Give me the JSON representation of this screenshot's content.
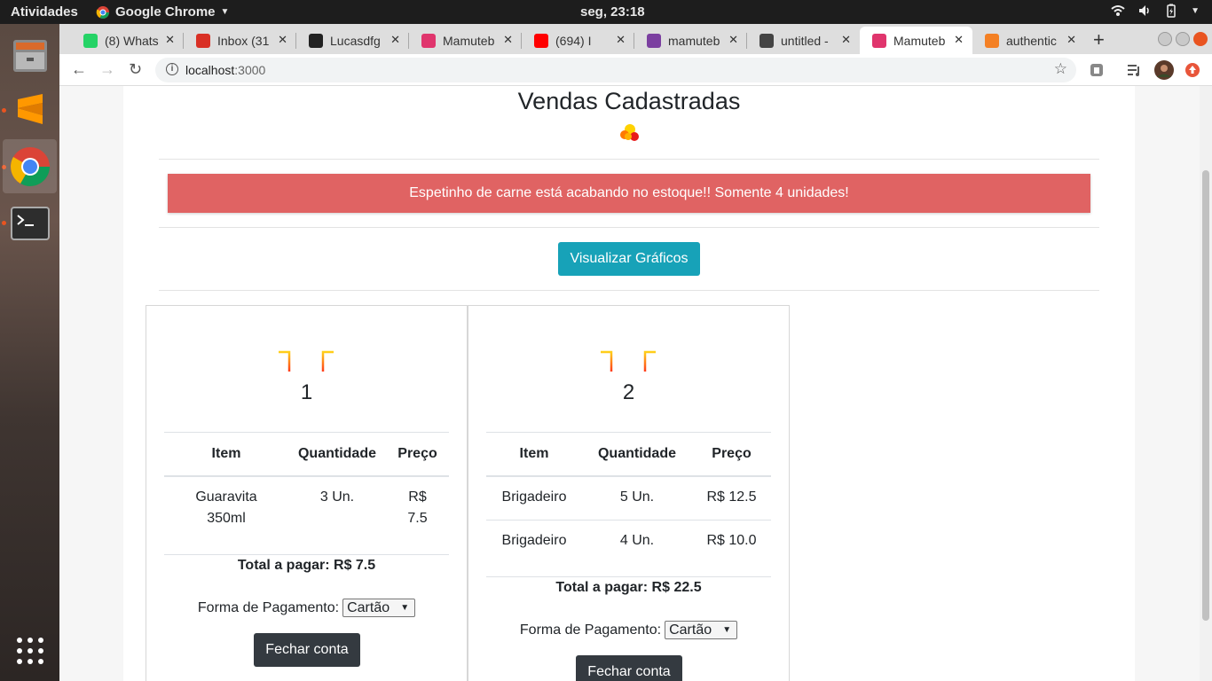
{
  "topbar": {
    "activities": "Atividades",
    "app_name": "Google Chrome",
    "clock": "seg, 23:18"
  },
  "browser": {
    "tabs": [
      {
        "label": "(8) Whats",
        "favicon_color": "#25d366",
        "active": false
      },
      {
        "label": "Inbox (31",
        "favicon_color": "#d93025",
        "active": false
      },
      {
        "label": "Lucasdfg",
        "favicon_color": "#222222",
        "active": false
      },
      {
        "label": "Mamuteb",
        "favicon_color": "#e0356d",
        "active": false
      },
      {
        "label": "(694) I",
        "favicon_color": "#ff0000",
        "active": false
      },
      {
        "label": "mamuteb",
        "favicon_color": "#7b3fa0",
        "active": false
      },
      {
        "label": "untitled -",
        "favicon_color": "#444444",
        "active": false
      },
      {
        "label": "Mamuteb",
        "favicon_color": "#e0356d",
        "active": true
      },
      {
        "label": "authentic",
        "favicon_color": "#f48024",
        "active": false
      }
    ],
    "url_host": "localhost",
    "url_port": ":3000"
  },
  "page": {
    "title": "Vendas Cadastradas",
    "alert": "Espetinho de carne está acabando no estoque!! Somente 4 unidades!",
    "graphs_button": "Visualizar Gráficos",
    "accent_color": "#17a2b8",
    "alert_color": "#e06363"
  },
  "tables": [
    {
      "number": "1",
      "headers": [
        "Item",
        "Quantidade",
        "Preço"
      ],
      "rows": [
        {
          "item_line1": "Guaravita",
          "item_line2": "350ml",
          "qty": "3 Un.",
          "price_line1": "R$",
          "price_line2": "7.5"
        }
      ],
      "total": "Total a pagar: R$ 7.5",
      "payment_label": "Forma de Pagamento:",
      "payment_value": "Cartão",
      "close_button": "Fechar conta"
    },
    {
      "number": "2",
      "headers": [
        "Item",
        "Quantidade",
        "Preço"
      ],
      "rows": [
        {
          "item": "Brigadeiro",
          "qty": "5 Un.",
          "price": "R$ 12.5"
        },
        {
          "item": "Brigadeiro",
          "qty": "4 Un.",
          "price": "R$ 10.0"
        }
      ],
      "total": "Total a pagar: R$ 22.5",
      "payment_label": "Forma de Pagamento:",
      "payment_value": "Cartão",
      "close_button": "Fechar conta"
    }
  ]
}
